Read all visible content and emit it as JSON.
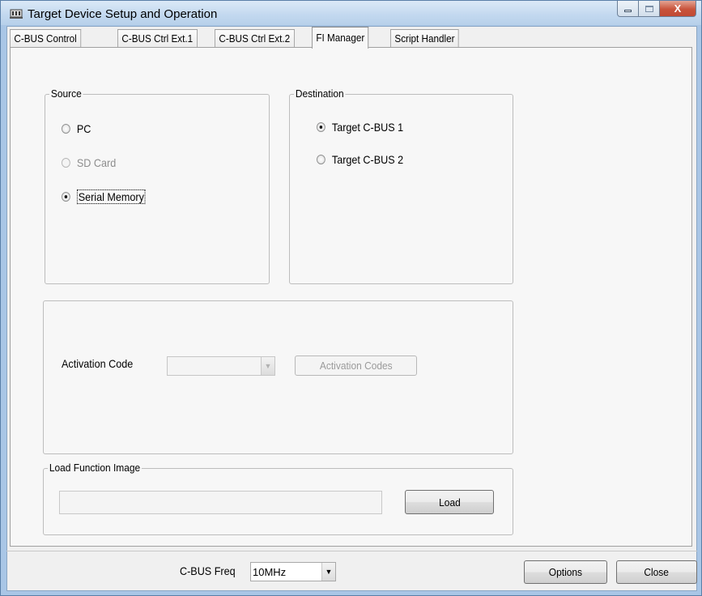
{
  "window": {
    "title": "Target Device Setup and Operation",
    "close_glyph": "X"
  },
  "tabs": [
    {
      "label": "C-BUS Control",
      "active": false
    },
    {
      "label": "C-BUS Ctrl Ext.1",
      "active": false
    },
    {
      "label": "C-BUS Ctrl Ext.2",
      "active": false
    },
    {
      "label": "FI Manager",
      "active": true
    },
    {
      "label": "Script Handler",
      "active": false
    }
  ],
  "source": {
    "label": "Source",
    "options": [
      {
        "label": "PC",
        "checked": false,
        "enabled": true
      },
      {
        "label": "SD Card",
        "checked": false,
        "enabled": false
      },
      {
        "label": "Serial Memory",
        "checked": true,
        "enabled": true
      }
    ]
  },
  "destination": {
    "label": "Destination",
    "options": [
      {
        "label": "Target C-BUS 1",
        "checked": true
      },
      {
        "label": "Target C-BUS 2",
        "checked": false
      }
    ]
  },
  "activation": {
    "label": "Activation Code",
    "value": "",
    "button_label": "Activation Codes"
  },
  "load": {
    "group_label": "Load Function Image",
    "path_value": "",
    "button_label": "Load"
  },
  "footer": {
    "freq_label": "C-BUS Freq",
    "freq_value": "10MHz",
    "options_label": "Options",
    "close_label": "Close"
  },
  "icons": [
    "app-icon",
    "minimize-icon",
    "maximize-icon",
    "close-icon",
    "dropdown-arrow-icon"
  ],
  "colors": {
    "title_gradient_top": "#dbe9f7",
    "frame": "#a9c6e6",
    "close_button": "#c8533b",
    "panel": "#f7f7f7"
  }
}
